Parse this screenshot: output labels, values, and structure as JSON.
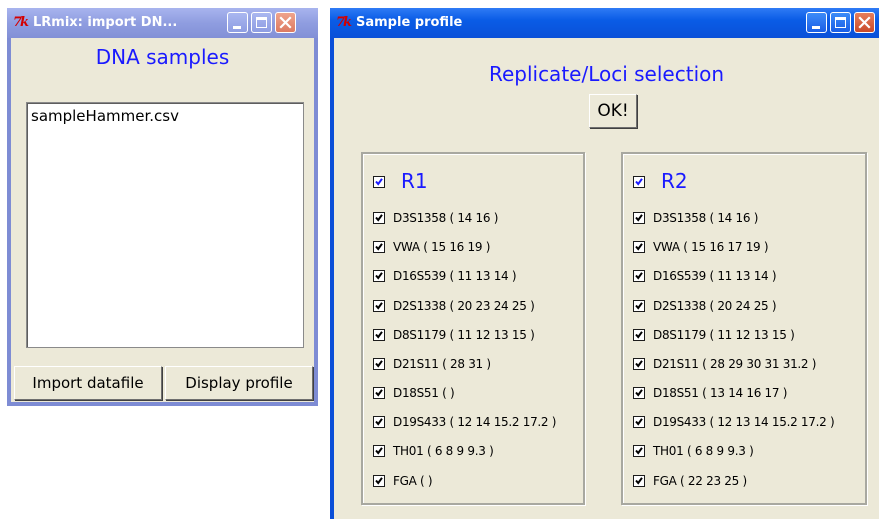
{
  "import_window": {
    "title": "LRmix: import DN...",
    "heading": "DNA samples",
    "files": [
      "sampleHammer.csv"
    ],
    "buttons": {
      "import": "Import datafile",
      "display": "Display profile"
    }
  },
  "profile_window": {
    "title": "Sample profile",
    "heading": "Replicate/Loci selection",
    "ok_label": "OK!",
    "replicates": [
      {
        "name": "R1",
        "checked": true,
        "loci": [
          {
            "label": "D3S1358 ( 14 16 )",
            "checked": true
          },
          {
            "label": "VWA ( 15 16 19 )",
            "checked": true
          },
          {
            "label": "D16S539 ( 11 13 14 )",
            "checked": true
          },
          {
            "label": "D2S1338 ( 20 23 24 25 )",
            "checked": true
          },
          {
            "label": "D8S1179 ( 11 12 13 15 )",
            "checked": true
          },
          {
            "label": "D21S11 ( 28 31 )",
            "checked": true
          },
          {
            "label": "D18S51 ( )",
            "checked": true
          },
          {
            "label": "D19S433 ( 12 14 15.2 17.2 )",
            "checked": true
          },
          {
            "label": "TH01 ( 6 8 9 9.3 )",
            "checked": true
          },
          {
            "label": "FGA ( )",
            "checked": true
          }
        ]
      },
      {
        "name": "R2",
        "checked": true,
        "loci": [
          {
            "label": "D3S1358 ( 14 16 )",
            "checked": true
          },
          {
            "label": "VWA ( 15 16 17 19 )",
            "checked": true
          },
          {
            "label": "D16S539 ( 11 13 14 )",
            "checked": true
          },
          {
            "label": "D2S1338 ( 20 24 25 )",
            "checked": true
          },
          {
            "label": "D8S1179 ( 11 12 13 15 )",
            "checked": true
          },
          {
            "label": "D21S11 ( 28 29 30 31 31.2 )",
            "checked": true
          },
          {
            "label": "D18S51 ( 13 14 16 17 )",
            "checked": true
          },
          {
            "label": "D19S433 ( 12 13 14 15.2 17.2 )",
            "checked": true
          },
          {
            "label": "TH01 ( 6 8 9 9.3 )",
            "checked": true
          },
          {
            "label": "FGA ( 22 23 25 )",
            "checked": true
          }
        ]
      }
    ]
  },
  "colors": {
    "heading": "#1a1aff",
    "window_bg": "#ece9d8",
    "active_title": "#0a5ce6",
    "inactive_title": "#8f9de0"
  },
  "icons": {
    "app": "tk-feather-icon",
    "minimize": "minimize-icon",
    "maximize": "maximize-icon",
    "close": "close-icon",
    "check": "checkmark-icon"
  }
}
